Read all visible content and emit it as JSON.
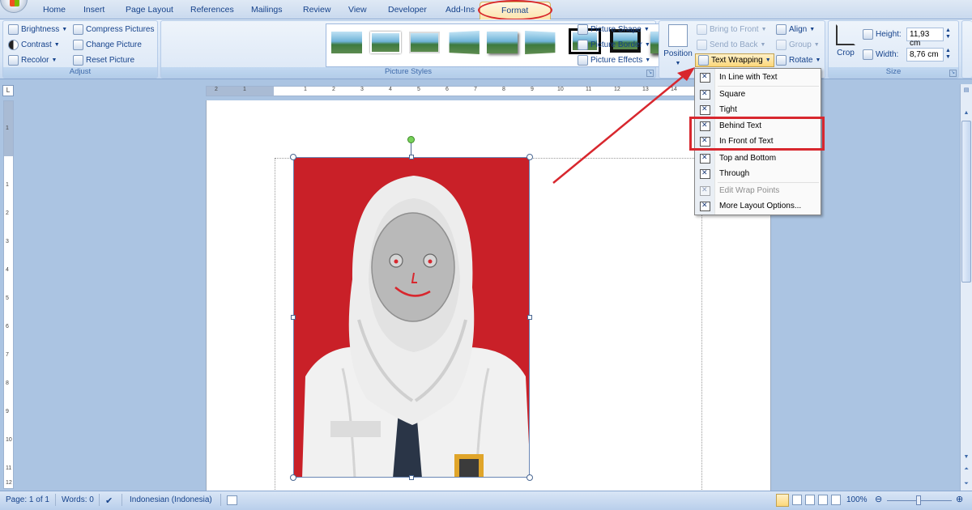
{
  "tabs": [
    {
      "label": "Home"
    },
    {
      "label": "Insert"
    },
    {
      "label": "Page Layout"
    },
    {
      "label": "References"
    },
    {
      "label": "Mailings"
    },
    {
      "label": "Review"
    },
    {
      "label": "View"
    },
    {
      "label": "Developer"
    },
    {
      "label": "Add-Ins"
    },
    {
      "label": "Format"
    }
  ],
  "adjust": {
    "label": "Adjust",
    "brightness": "Brightness",
    "contrast": "Contrast",
    "recolor": "Recolor",
    "compress": "Compress Pictures",
    "change": "Change Picture",
    "reset": "Reset Picture"
  },
  "picture_styles": {
    "label": "Picture Styles",
    "shape": "Picture Shape",
    "border": "Picture Border",
    "effects": "Picture Effects"
  },
  "arrange": {
    "position": "Position",
    "text_wrapping": "Text Wrapping",
    "bring_to_front": "Bring to Front",
    "send_to_back": "Send to Back",
    "align": "Align",
    "group": "Group",
    "rotate": "Rotate"
  },
  "size": {
    "label": "Size",
    "crop": "Crop",
    "height_label": "Height:",
    "height_value": "11,93 cm",
    "width_label": "Width:",
    "width_value": "8,76 cm"
  },
  "wrap_menu": {
    "items": [
      {
        "label": "In Line with Text"
      },
      {
        "label": "Square"
      },
      {
        "label": "Tight"
      },
      {
        "label": "Behind Text"
      },
      {
        "label": "In Front of Text"
      },
      {
        "label": "Top and Bottom"
      },
      {
        "label": "Through"
      },
      {
        "label": "Edit Wrap Points"
      },
      {
        "label": "More Layout Options..."
      }
    ]
  },
  "ruler_h": [
    "2",
    "1",
    "1",
    "2",
    "3",
    "4",
    "5",
    "6",
    "7",
    "8",
    "9",
    "10",
    "11",
    "12",
    "13",
    "14",
    "15"
  ],
  "ruler_v": [
    "1",
    "1",
    "2",
    "3",
    "4",
    "5",
    "6",
    "7",
    "8",
    "9",
    "10",
    "11",
    "12"
  ],
  "status": {
    "page": "Page: 1 of 1",
    "words": "Words: 0",
    "language": "Indonesian (Indonesia)",
    "zoom": "100%"
  },
  "colors": {
    "annotation_red": "#d8272e",
    "photo_background": "#c92028",
    "ribbon_text": "#15428b"
  }
}
